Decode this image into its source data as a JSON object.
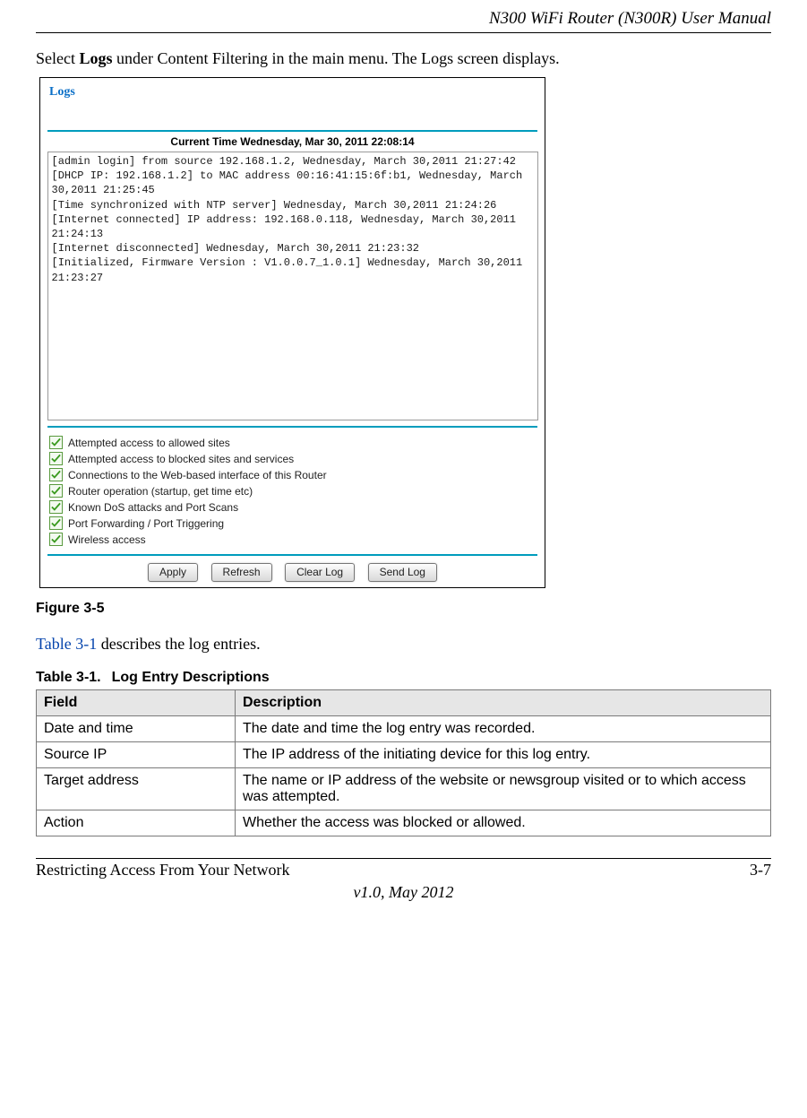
{
  "header": {
    "title": "N300 WiFi Router (N300R) User Manual"
  },
  "intro": {
    "before": "Select ",
    "bold": "Logs",
    "after": " under Content Filtering in the main menu. The Logs screen displays."
  },
  "figure": {
    "logs_heading": "Logs",
    "current_time": "Current Time Wednesday, Mar 30, 2011 22:08:14",
    "log_lines": [
      "[admin login] from source 192.168.1.2, Wednesday, March 30,2011 21:27:42",
      "[DHCP IP: 192.168.1.2] to MAC address 00:16:41:15:6f:b1, Wednesday, March 30,2011 21:25:45",
      "[Time synchronized with NTP server] Wednesday, March 30,2011 21:24:26",
      "[Internet connected] IP address: 192.168.0.118, Wednesday, March 30,2011 21:24:13",
      "[Internet disconnected] Wednesday, March 30,2011 21:23:32",
      "[Initialized, Firmware Version : V1.0.0.7_1.0.1] Wednesday, March 30,2011 21:23:27"
    ],
    "checkboxes": [
      {
        "label": "Attempted access to allowed sites",
        "checked": true
      },
      {
        "label": "Attempted access to blocked sites and services",
        "checked": true
      },
      {
        "label": "Connections to the Web-based interface of this Router",
        "checked": true
      },
      {
        "label": "Router operation (startup, get time etc)",
        "checked": true
      },
      {
        "label": "Known DoS attacks and Port Scans",
        "checked": true
      },
      {
        "label": "Port Forwarding / Port Triggering",
        "checked": true
      },
      {
        "label": "Wireless access",
        "checked": true
      }
    ],
    "buttons": {
      "apply": "Apply",
      "refresh": "Refresh",
      "clear": "Clear Log",
      "send": "Send Log"
    },
    "caption": "Figure 3-5"
  },
  "table_intro": {
    "link": "Table 3-1",
    "rest": " describes the log entries."
  },
  "table": {
    "title_num": "Table 3-1.",
    "title_text": "Log Entry Descriptions",
    "headers": {
      "field": "Field",
      "desc": "Description"
    },
    "rows": [
      {
        "field": "Date and time",
        "desc": "The date and time the log entry was recorded."
      },
      {
        "field": "Source IP",
        "desc": "The IP address of the initiating device for this log entry."
      },
      {
        "field": "Target address",
        "desc": "The name or IP address of the website or newsgroup visited or to which access was attempted."
      },
      {
        "field": "Action",
        "desc": "Whether the access was blocked or allowed."
      }
    ]
  },
  "footer": {
    "left": "Restricting Access From Your Network",
    "right": "3-7",
    "version": "v1.0, May 2012"
  }
}
